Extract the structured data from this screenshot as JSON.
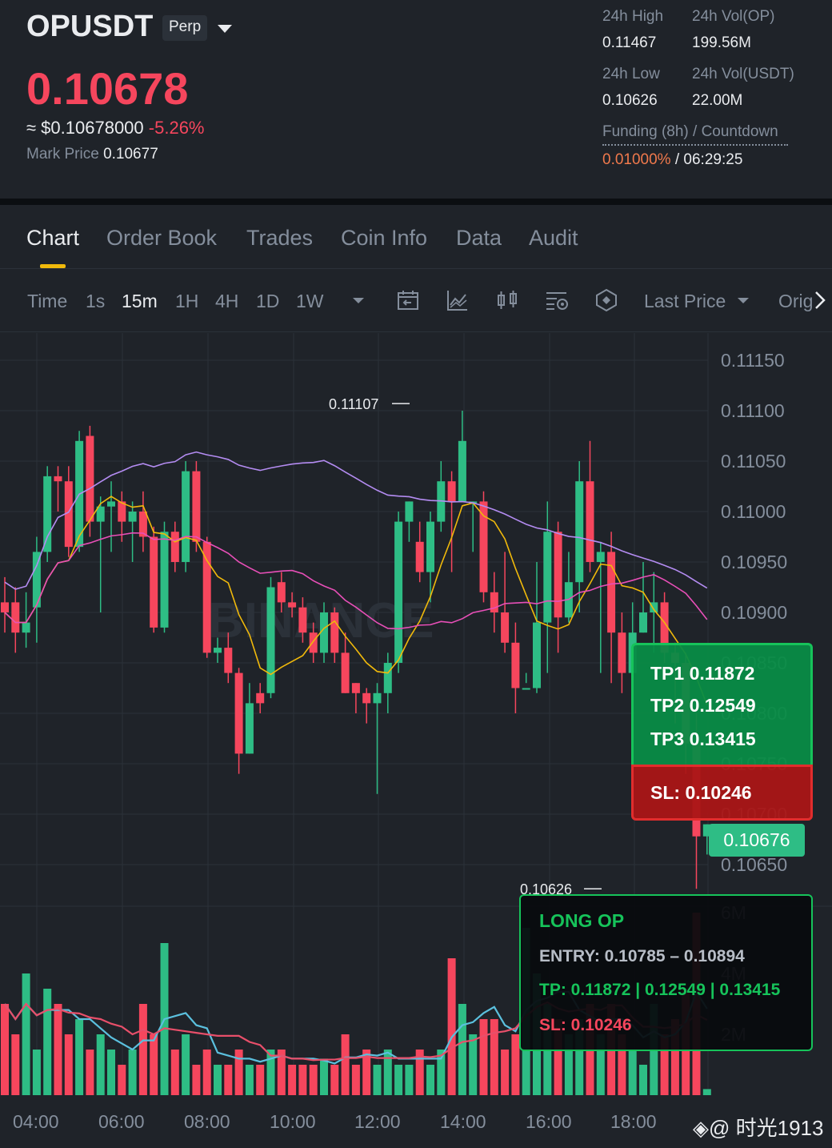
{
  "header": {
    "symbol": "OPUSDT",
    "contract_type": "Perp",
    "last_price": "0.10678",
    "usd_equiv_prefix": "≈ $0.10678000",
    "change_pct": "-5.26%",
    "mark_price_label": "Mark Price",
    "mark_price": "0.10677",
    "stats": {
      "high_label": "24h High",
      "high": "0.11467",
      "vol_op_label": "24h Vol(OP)",
      "vol_op": "199.56M",
      "low_label": "24h Low",
      "low": "0.10626",
      "vol_usdt_label": "24h Vol(USDT)",
      "vol_usdt": "22.00M",
      "funding_label": "Funding (8h) / Countdown",
      "funding_rate": "0.01000%",
      "funding_sep": "/",
      "countdown": "06:29:25"
    }
  },
  "tabs": [
    "Chart",
    "Order Book",
    "Trades",
    "Coin Info",
    "Data",
    "Audit"
  ],
  "toolbar": {
    "time_label": "Time",
    "intervals": [
      "1s",
      "15m",
      "1H",
      "4H",
      "1D",
      "1W"
    ],
    "active_interval": "15m",
    "price_type": "Last Price",
    "original_label": "Orig"
  },
  "chart_data": {
    "type": "candlestick",
    "y_ticks": [
      "0.11150",
      "0.11100",
      "0.11050",
      "0.11000",
      "0.10950",
      "0.10900",
      "0.10850",
      "0.10800",
      "0.10750",
      "0.10700",
      "0.10650"
    ],
    "x_ticks": [
      "04:00",
      "06:00",
      "08:00",
      "10:00",
      "12:00",
      "14:00",
      "16:00",
      "18:00"
    ],
    "vol_ticks": [
      "6M",
      "4M",
      "2M"
    ],
    "high_marker": "0.11107",
    "low_marker": "0.10626",
    "current_price": "0.10676",
    "ylim": [
      0.1061,
      0.1117
    ],
    "candles": [
      [
        0.1091,
        0.109,
        0.10935,
        0.1088
      ],
      [
        0.1091,
        0.1088,
        0.10925,
        0.1086
      ],
      [
        0.1088,
        0.1089,
        0.1092,
        0.10865
      ],
      [
        0.10905,
        0.1096,
        0.10975,
        0.1087
      ],
      [
        0.1096,
        0.11035,
        0.11045,
        0.1095
      ],
      [
        0.11035,
        0.1103,
        0.11045,
        0.11
      ],
      [
        0.1103,
        0.10965,
        0.11045,
        0.10955
      ],
      [
        0.10965,
        0.1107,
        0.1108,
        0.1096
      ],
      [
        0.11075,
        0.1099,
        0.11085,
        0.10975
      ],
      [
        0.1099,
        0.11005,
        0.11015,
        0.109
      ],
      [
        0.11005,
        0.1101,
        0.1103,
        0.1096
      ],
      [
        0.1101,
        0.1099,
        0.1102,
        0.1097
      ],
      [
        0.1099,
        0.11,
        0.1101,
        0.1095
      ],
      [
        0.11,
        0.10975,
        0.1102,
        0.1096
      ],
      [
        0.10975,
        0.10885,
        0.10985,
        0.1088
      ],
      [
        0.10885,
        0.1098,
        0.1099,
        0.1088
      ],
      [
        0.1098,
        0.1095,
        0.1099,
        0.1094
      ],
      [
        0.1095,
        0.1104,
        0.1105,
        0.1094
      ],
      [
        0.1104,
        0.1097,
        0.1105,
        0.1096
      ],
      [
        0.1097,
        0.1086,
        0.10975,
        0.10855
      ],
      [
        0.1086,
        0.10865,
        0.10875,
        0.1085
      ],
      [
        0.10865,
        0.1084,
        0.1088,
        0.1083
      ],
      [
        0.1084,
        0.1076,
        0.10845,
        0.1074
      ],
      [
        0.1076,
        0.1081,
        0.1083,
        0.1076
      ],
      [
        0.1082,
        0.1081,
        0.1083,
        0.108
      ],
      [
        0.1082,
        0.10925,
        0.10935,
        0.10815
      ],
      [
        0.1093,
        0.1091,
        0.1094,
        0.109
      ],
      [
        0.1091,
        0.10905,
        0.1092,
        0.10895
      ],
      [
        0.10905,
        0.1088,
        0.10915,
        0.1087
      ],
      [
        0.1088,
        0.1086,
        0.1089,
        0.1085
      ],
      [
        0.1086,
        0.109,
        0.1091,
        0.1085
      ],
      [
        0.109,
        0.1086,
        0.10905,
        0.1085
      ],
      [
        0.1086,
        0.1082,
        0.1088,
        0.1082
      ],
      [
        0.1083,
        0.1082,
        0.1083,
        0.108
      ],
      [
        0.1082,
        0.1081,
        0.10825,
        0.1079
      ],
      [
        0.1081,
        0.1082,
        0.1083,
        0.1072
      ],
      [
        0.1082,
        0.1085,
        0.1086,
        0.108
      ],
      [
        0.1085,
        0.1099,
        0.11,
        0.1084
      ],
      [
        0.1099,
        0.1101,
        0.1101,
        0.1097
      ],
      [
        0.1097,
        0.1094,
        0.1099,
        0.1093
      ],
      [
        0.1094,
        0.1099,
        0.11,
        0.1091
      ],
      [
        0.1099,
        0.1103,
        0.1105,
        0.1098
      ],
      [
        0.1103,
        0.1101,
        0.1104,
        0.1094
      ],
      [
        0.1101,
        0.1107,
        0.111,
        0.1101
      ],
      [
        0.1101,
        0.1101,
        0.1101,
        0.1096
      ],
      [
        0.1101,
        0.1092,
        0.1102,
        0.1091
      ],
      [
        0.1092,
        0.109,
        0.1094,
        0.1088
      ],
      [
        0.109,
        0.1087,
        0.1096,
        0.1086
      ],
      [
        0.1087,
        0.10825,
        0.1089,
        0.108
      ],
      [
        0.10825,
        0.10825,
        0.1084,
        0.1083
      ],
      [
        0.10825,
        0.1089,
        0.1095,
        0.1082
      ],
      [
        0.1089,
        0.1098,
        0.1101,
        0.1084
      ],
      [
        0.1098,
        0.10895,
        0.1099,
        0.1086
      ],
      [
        0.10895,
        0.1093,
        0.1096,
        0.1089
      ],
      [
        0.1093,
        0.1103,
        0.1105,
        0.109
      ],
      [
        0.1103,
        0.1095,
        0.1107,
        0.1094
      ],
      [
        0.1095,
        0.1096,
        0.1097,
        0.1084
      ],
      [
        0.1096,
        0.1088,
        0.1098,
        0.1083
      ],
      [
        0.1088,
        0.1084,
        0.109,
        0.1082
      ],
      [
        0.1084,
        0.1088,
        0.1091,
        0.1079
      ],
      [
        0.1088,
        0.109,
        0.1095,
        0.1088
      ],
      [
        0.109,
        0.1091,
        0.1094,
        0.1086
      ],
      [
        0.1091,
        0.1086,
        0.1092,
        0.1085
      ],
      [
        0.1086,
        0.1085,
        0.1087,
        0.1079
      ],
      [
        0.1085,
        0.1077,
        0.1086,
        0.1074
      ],
      [
        0.1077,
        0.10678,
        0.108,
        0.10626
      ],
      [
        0.10678,
        0.1069,
        0.1069,
        0.1066
      ]
    ],
    "volume": [
      3,
      2,
      4,
      1.5,
      3.5,
      3,
      2,
      2.5,
      1.5,
      2,
      1.5,
      1,
      1.5,
      3,
      2,
      5,
      1.5,
      2,
      1,
      1.5,
      1,
      1,
      1.5,
      1,
      1,
      1.5,
      1.5,
      1,
      1,
      1,
      1.2,
      1,
      2,
      1,
      1.5,
      1,
      1.5,
      1,
      1,
      1.5,
      1,
      1.5,
      4.5,
      3,
      2,
      2.5,
      2.5,
      1.5,
      2,
      5.5,
      4,
      3,
      2.5,
      2,
      2.5,
      3,
      2,
      3,
      2,
      1.5,
      1,
      3,
      2,
      2.5,
      3.5,
      6,
      0.2
    ]
  },
  "signal": {
    "tp1": "TP1 0.11872",
    "tp2": "TP2 0.12549",
    "tp3": "TP3 0.13415",
    "sl": "SL: 0.10246",
    "title": "LONG OP",
    "entry": "ENTRY: 0.10785 – 0.10894",
    "tp": "TP: 0.11872 | 0.12549 | 0.13415",
    "sl2": "SL: 0.10246"
  },
  "watermark": "@ 时光1913",
  "chart_watermark": "BINANCE"
}
